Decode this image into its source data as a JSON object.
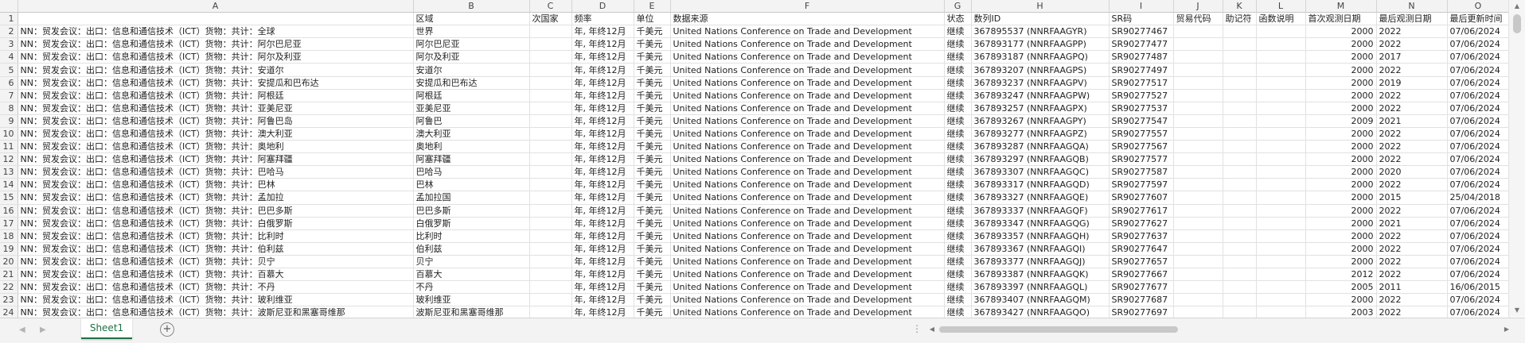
{
  "columns": [
    "",
    "A",
    "B",
    "C",
    "D",
    "E",
    "F",
    "G",
    "H",
    "I",
    "J",
    "K",
    "L",
    "M",
    "N",
    "O"
  ],
  "header_row": {
    "num": "1",
    "cells": [
      "",
      "区域",
      "次国家",
      "频率",
      "单位",
      "数据来源",
      "状态",
      "数列ID",
      "SR码",
      "贸易代码",
      "助记符",
      "函数说明",
      "首次观测日期",
      "最后观测日期",
      "最后更新时间"
    ]
  },
  "rows": [
    {
      "num": "2",
      "cells": [
        "NN：贸发会议：出口：信息和通信技术（ICT）货物：共计：全球",
        "世界",
        "",
        "年, 年终12月",
        "千美元",
        "United Nations Conference on Trade and Development",
        "继续",
        "367895537 (NNRFAAGYR)",
        "SR90277467",
        "",
        "",
        "",
        "2000",
        "2022",
        "07/06/2024"
      ]
    },
    {
      "num": "3",
      "cells": [
        "NN：贸发会议：出口：信息和通信技术（ICT）货物：共计：阿尔巴尼亚",
        "阿尔巴尼亚",
        "",
        "年, 年终12月",
        "千美元",
        "United Nations Conference on Trade and Development",
        "继续",
        "367893177 (NNRFAAGPP)",
        "SR90277477",
        "",
        "",
        "",
        "2000",
        "2022",
        "07/06/2024"
      ]
    },
    {
      "num": "4",
      "cells": [
        "NN：贸发会议：出口：信息和通信技术（ICT）货物：共计：阿尔及利亚",
        "阿尔及利亚",
        "",
        "年, 年终12月",
        "千美元",
        "United Nations Conference on Trade and Development",
        "继续",
        "367893187 (NNRFAAGPQ)",
        "SR90277487",
        "",
        "",
        "",
        "2000",
        "2017",
        "07/06/2024"
      ]
    },
    {
      "num": "5",
      "cells": [
        "NN：贸发会议：出口：信息和通信技术（ICT）货物：共计：安道尔",
        "安道尔",
        "",
        "年, 年终12月",
        "千美元",
        "United Nations Conference on Trade and Development",
        "继续",
        "367893207 (NNRFAAGPS)",
        "SR90277497",
        "",
        "",
        "",
        "2000",
        "2022",
        "07/06/2024"
      ]
    },
    {
      "num": "6",
      "cells": [
        "NN：贸发会议：出口：信息和通信技术（ICT）货物：共计：安提瓜和巴布达",
        "安提瓜和巴布达",
        "",
        "年, 年终12月",
        "千美元",
        "United Nations Conference on Trade and Development",
        "继续",
        "367893237 (NNRFAAGPV)",
        "SR90277517",
        "",
        "",
        "",
        "2000",
        "2019",
        "07/06/2024"
      ]
    },
    {
      "num": "7",
      "cells": [
        "NN：贸发会议：出口：信息和通信技术（ICT）货物：共计：阿根廷",
        "阿根廷",
        "",
        "年, 年终12月",
        "千美元",
        "United Nations Conference on Trade and Development",
        "继续",
        "367893247 (NNRFAAGPW)",
        "SR90277527",
        "",
        "",
        "",
        "2000",
        "2022",
        "07/06/2024"
      ]
    },
    {
      "num": "8",
      "cells": [
        "NN：贸发会议：出口：信息和通信技术（ICT）货物：共计：亚美尼亚",
        "亚美尼亚",
        "",
        "年, 年终12月",
        "千美元",
        "United Nations Conference on Trade and Development",
        "继续",
        "367893257 (NNRFAAGPX)",
        "SR90277537",
        "",
        "",
        "",
        "2000",
        "2022",
        "07/06/2024"
      ]
    },
    {
      "num": "9",
      "cells": [
        "NN：贸发会议：出口：信息和通信技术（ICT）货物：共计：阿鲁巴岛",
        "阿鲁巴",
        "",
        "年, 年终12月",
        "千美元",
        "United Nations Conference on Trade and Development",
        "继续",
        "367893267 (NNRFAAGPY)",
        "SR90277547",
        "",
        "",
        "",
        "2009",
        "2021",
        "07/06/2024"
      ]
    },
    {
      "num": "10",
      "cells": [
        "NN：贸发会议：出口：信息和通信技术（ICT）货物：共计：澳大利亚",
        "澳大利亚",
        "",
        "年, 年终12月",
        "千美元",
        "United Nations Conference on Trade and Development",
        "继续",
        "367893277 (NNRFAAGPZ)",
        "SR90277557",
        "",
        "",
        "",
        "2000",
        "2022",
        "07/06/2024"
      ]
    },
    {
      "num": "11",
      "cells": [
        "NN：贸发会议：出口：信息和通信技术（ICT）货物：共计：奥地利",
        "奥地利",
        "",
        "年, 年终12月",
        "千美元",
        "United Nations Conference on Trade and Development",
        "继续",
        "367893287 (NNRFAAGQA)",
        "SR90277567",
        "",
        "",
        "",
        "2000",
        "2022",
        "07/06/2024"
      ]
    },
    {
      "num": "12",
      "cells": [
        "NN：贸发会议：出口：信息和通信技术（ICT）货物：共计：阿塞拜疆",
        "阿塞拜疆",
        "",
        "年, 年终12月",
        "千美元",
        "United Nations Conference on Trade and Development",
        "继续",
        "367893297 (NNRFAAGQB)",
        "SR90277577",
        "",
        "",
        "",
        "2000",
        "2022",
        "07/06/2024"
      ]
    },
    {
      "num": "13",
      "cells": [
        "NN：贸发会议：出口：信息和通信技术（ICT）货物：共计：巴哈马",
        "巴哈马",
        "",
        "年, 年终12月",
        "千美元",
        "United Nations Conference on Trade and Development",
        "继续",
        "367893307 (NNRFAAGQC)",
        "SR90277587",
        "",
        "",
        "",
        "2000",
        "2020",
        "07/06/2024"
      ]
    },
    {
      "num": "14",
      "cells": [
        "NN：贸发会议：出口：信息和通信技术（ICT）货物：共计：巴林",
        "巴林",
        "",
        "年, 年终12月",
        "千美元",
        "United Nations Conference on Trade and Development",
        "继续",
        "367893317 (NNRFAAGQD)",
        "SR90277597",
        "",
        "",
        "",
        "2000",
        "2022",
        "07/06/2024"
      ]
    },
    {
      "num": "15",
      "cells": [
        "NN：贸发会议：出口：信息和通信技术（ICT）货物：共计：孟加拉",
        "孟加拉国",
        "",
        "年, 年终12月",
        "千美元",
        "United Nations Conference on Trade and Development",
        "继续",
        "367893327 (NNRFAAGQE)",
        "SR90277607",
        "",
        "",
        "",
        "2000",
        "2015",
        "25/04/2018"
      ]
    },
    {
      "num": "16",
      "cells": [
        "NN：贸发会议：出口：信息和通信技术（ICT）货物：共计：巴巴多斯",
        "巴巴多斯",
        "",
        "年, 年终12月",
        "千美元",
        "United Nations Conference on Trade and Development",
        "继续",
        "367893337 (NNRFAAGQF)",
        "SR90277617",
        "",
        "",
        "",
        "2000",
        "2022",
        "07/06/2024"
      ]
    },
    {
      "num": "17",
      "cells": [
        "NN：贸发会议：出口：信息和通信技术（ICT）货物：共计：白俄罗斯",
        "白俄罗斯",
        "",
        "年, 年终12月",
        "千美元",
        "United Nations Conference on Trade and Development",
        "继续",
        "367893347 (NNRFAAGQG)",
        "SR90277627",
        "",
        "",
        "",
        "2000",
        "2021",
        "07/06/2024"
      ]
    },
    {
      "num": "18",
      "cells": [
        "NN：贸发会议：出口：信息和通信技术（ICT）货物：共计：比利时",
        "比利时",
        "",
        "年, 年终12月",
        "千美元",
        "United Nations Conference on Trade and Development",
        "继续",
        "367893357 (NNRFAAGQH)",
        "SR90277637",
        "",
        "",
        "",
        "2000",
        "2022",
        "07/06/2024"
      ]
    },
    {
      "num": "19",
      "cells": [
        "NN：贸发会议：出口：信息和通信技术（ICT）货物：共计：伯利兹",
        "伯利兹",
        "",
        "年, 年终12月",
        "千美元",
        "United Nations Conference on Trade and Development",
        "继续",
        "367893367 (NNRFAAGQI)",
        "SR90277647",
        "",
        "",
        "",
        "2000",
        "2022",
        "07/06/2024"
      ]
    },
    {
      "num": "20",
      "cells": [
        "NN：贸发会议：出口：信息和通信技术（ICT）货物：共计：贝宁",
        "贝宁",
        "",
        "年, 年终12月",
        "千美元",
        "United Nations Conference on Trade and Development",
        "继续",
        "367893377 (NNRFAAGQJ)",
        "SR90277657",
        "",
        "",
        "",
        "2000",
        "2022",
        "07/06/2024"
      ]
    },
    {
      "num": "21",
      "cells": [
        "NN：贸发会议：出口：信息和通信技术（ICT）货物：共计：百慕大",
        "百慕大",
        "",
        "年, 年终12月",
        "千美元",
        "United Nations Conference on Trade and Development",
        "继续",
        "367893387 (NNRFAAGQK)",
        "SR90277667",
        "",
        "",
        "",
        "2012",
        "2022",
        "07/06/2024"
      ]
    },
    {
      "num": "22",
      "cells": [
        "NN：贸发会议：出口：信息和通信技术（ICT）货物：共计：不丹",
        "不丹",
        "",
        "年, 年终12月",
        "千美元",
        "United Nations Conference on Trade and Development",
        "继续",
        "367893397 (NNRFAAGQL)",
        "SR90277677",
        "",
        "",
        "",
        "2005",
        "2011",
        "16/06/2015"
      ]
    },
    {
      "num": "23",
      "cells": [
        "NN：贸发会议：出口：信息和通信技术（ICT）货物：共计：玻利维亚",
        "玻利维亚",
        "",
        "年, 年终12月",
        "千美元",
        "United Nations Conference on Trade and Development",
        "继续",
        "367893407 (NNRFAAGQM)",
        "SR90277687",
        "",
        "",
        "",
        "2000",
        "2022",
        "07/06/2024"
      ]
    },
    {
      "num": "24",
      "cells": [
        "NN：贸发会议：出口：信息和通信技术（ICT）货物：共计：波斯尼亚和黑塞哥维那",
        "波斯尼亚和黑塞哥维那",
        "",
        "年, 年终12月",
        "千美元",
        "United Nations Conference on Trade and Development",
        "继续",
        "367893427 (NNRFAAGQO)",
        "SR90277697",
        "",
        "",
        "",
        "2003",
        "2022",
        "07/06/2024"
      ]
    }
  ],
  "sheet_tab": "Sheet1",
  "add_sheet_symbol": "+",
  "scroll_dots": "⋮"
}
